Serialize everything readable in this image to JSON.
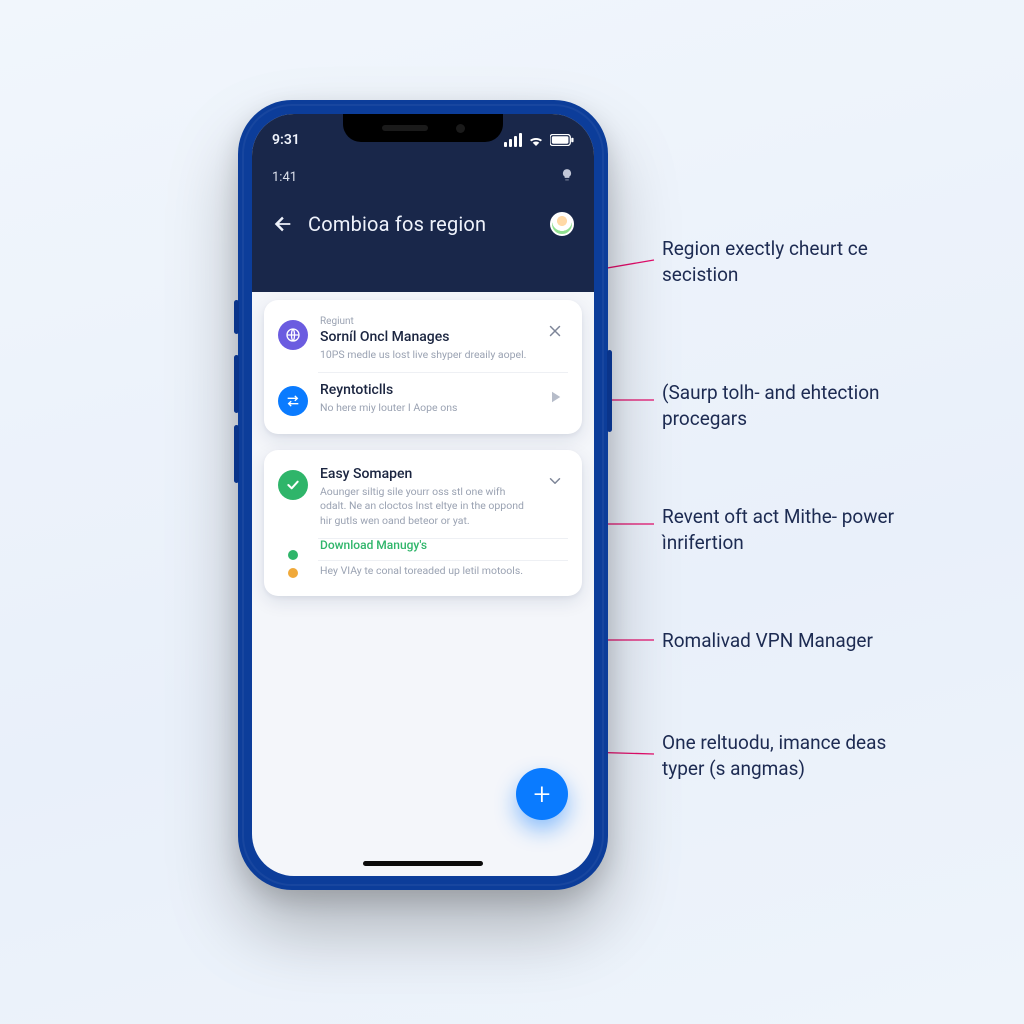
{
  "status": {
    "time": "9:31",
    "subtime": "1:41"
  },
  "header": {
    "title": "Combioa fos region"
  },
  "cards": [
    {
      "rows": [
        {
          "eyebrow": "Regiunt",
          "title": "Sorníl Oncl Manages",
          "sub": "10PS medle us lost live shyper dreaily aopel.",
          "action": "close",
          "icon": "globe"
        },
        {
          "title": "Reyntoticlls",
          "sub": "No here miy louter I Aope ons",
          "action": "play",
          "icon": "arrows"
        }
      ]
    },
    {
      "rows": [
        {
          "title": "Easy Somapen",
          "sub": "Aounger siltig sile yourr oss stl one wifh odalt. Ne an cloctos lnst eltye in the oppond hir gutls wen oand beteor or yat.",
          "action": "chevron",
          "icon": "check",
          "link": "Download Manugy's",
          "tail": "Hey VIAy te conal toreaded up letil motools."
        }
      ]
    }
  ],
  "annotations": {
    "a1": "Region exectly cheurt ce secistion",
    "a2": "(Saurp tolh- and ehtection procegars",
    "a3": "Revent oft act Mithe- power ìnrifertion",
    "a4": "Romalivad VPN Manager",
    "a5": "One reltuodu, imance deas typer (s angmas)"
  }
}
